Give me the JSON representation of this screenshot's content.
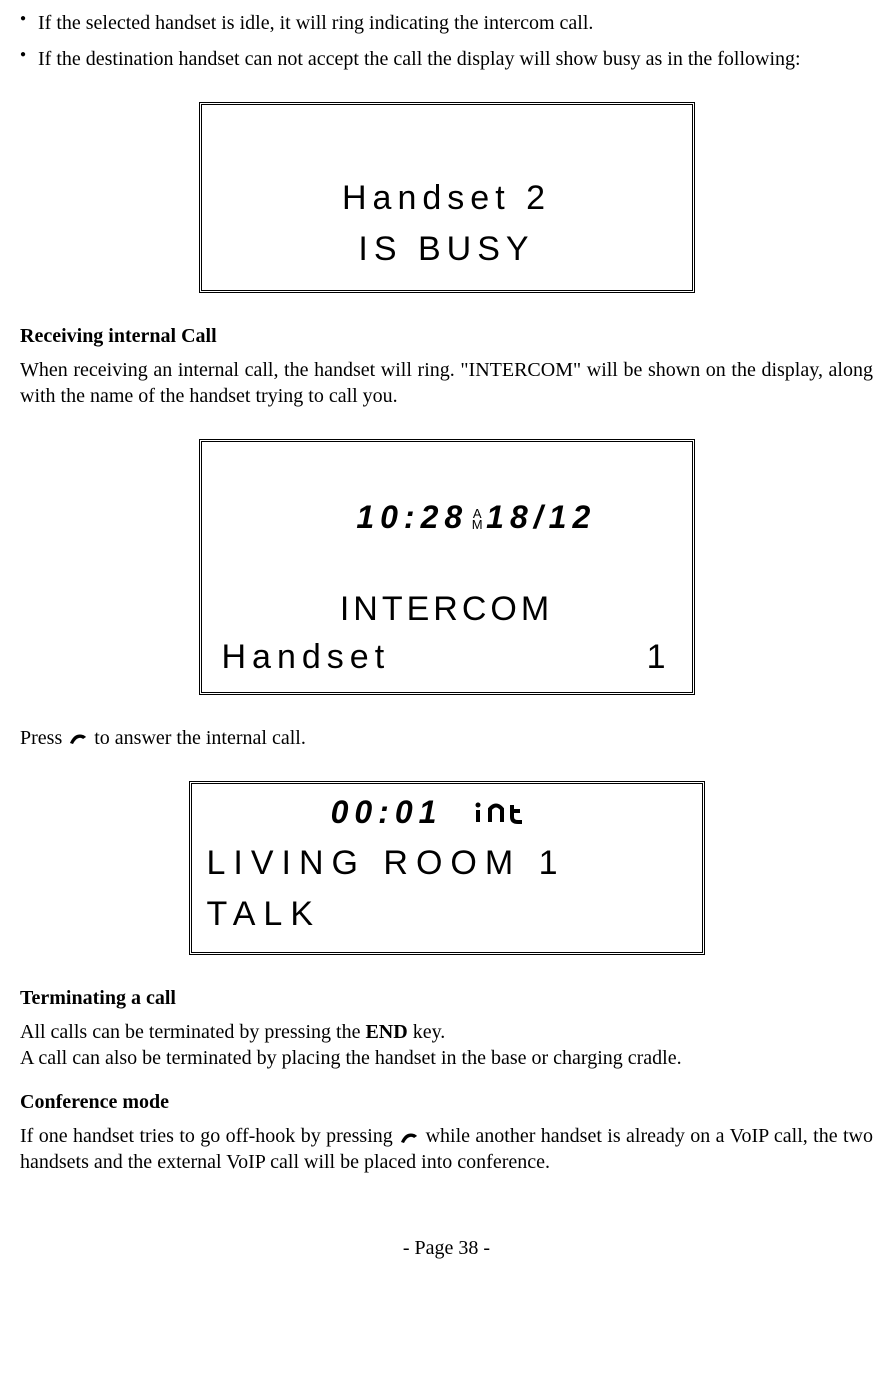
{
  "bullets": {
    "b1": "If the selected handset is idle, it will ring indicating the intercom call.",
    "b2": "If the destination handset can not accept the call the display will show busy as in the following:"
  },
  "lcd_busy": {
    "line1": "Handset 2",
    "line2": "IS BUSY"
  },
  "receiving_heading": "Receiving internal Call",
  "receiving_body": "When receiving an internal call, the handset will ring. \"INTERCOM\" will be shown on the display, along with the name of the handset trying to call you.",
  "lcd_intercom": {
    "time": "10:28",
    "ampm_top": "A",
    "ampm_bottom": "M",
    "date": "18/12",
    "label": "INTERCOM",
    "handset_label": "Handset",
    "handset_num": "1"
  },
  "press_text_pre": "Press ",
  "press_text_post": " to answer the internal call.",
  "lcd_talk": {
    "time": "00:01",
    "line1": "LIVING ROOM 1",
    "line2": "TALK"
  },
  "terminating_heading": "Terminating a call",
  "terminating_body_pre": "All calls can be terminated by pressing the ",
  "terminating_key": "END",
  "terminating_body_post": " key.",
  "terminating_body2": "A call can also be terminated by placing the handset in the base or charging cradle.",
  "conference_heading": "Conference mode",
  "conference_body_pre": "If one handset tries to go off-hook by pressing ",
  "conference_body_post": " while another handset is already on a VoIP call, the two handsets and the external VoIP call will be placed into conference.",
  "footer": "- Page 38 -"
}
